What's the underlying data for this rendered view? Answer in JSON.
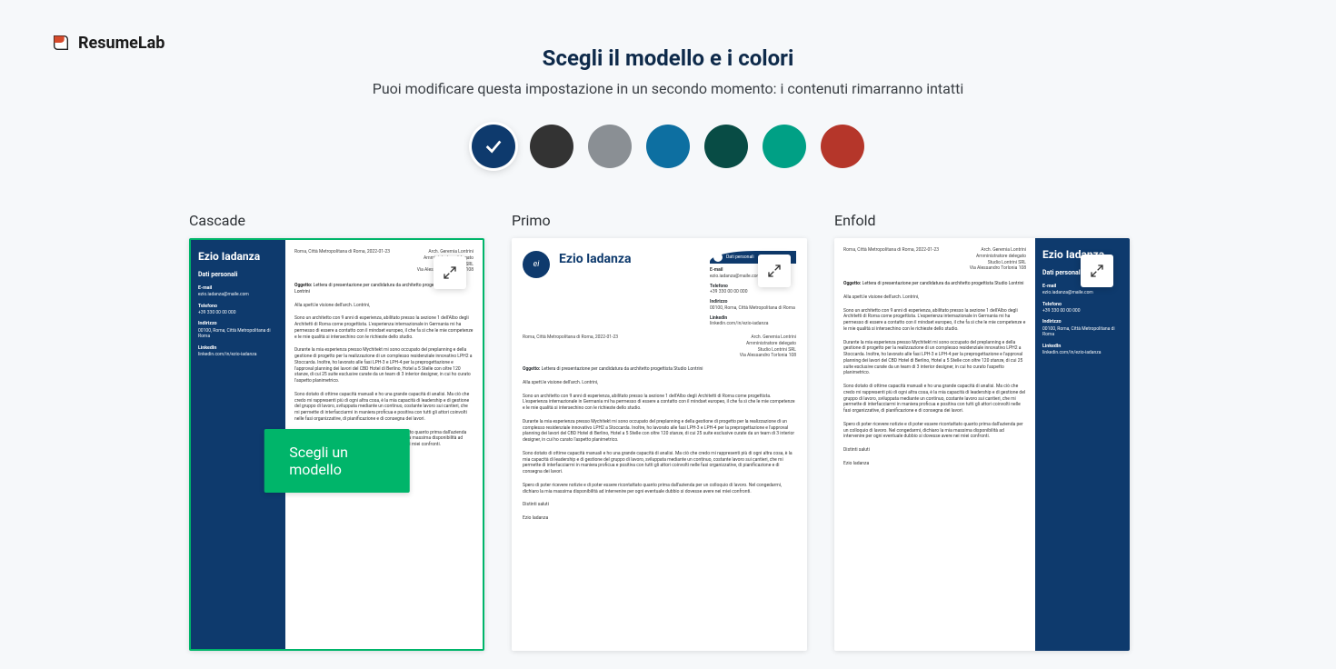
{
  "brand": "ResumeLab",
  "heading": "Scegli il modello e i colori",
  "subtitle": "Puoi modificare questa impostazione in un secondo momento: i contenuti rimarranno intatti",
  "colors": [
    {
      "name": "navy",
      "hex": "#0e3a6d",
      "selected": true
    },
    {
      "name": "charcoal",
      "hex": "#333333",
      "selected": false
    },
    {
      "name": "gray",
      "hex": "#8a8f94",
      "selected": false
    },
    {
      "name": "blue",
      "hex": "#0d6fa1",
      "selected": false
    },
    {
      "name": "dark-teal",
      "hex": "#084c45",
      "selected": false
    },
    {
      "name": "teal",
      "hex": "#00a085",
      "selected": false
    },
    {
      "name": "red",
      "hex": "#b5362a",
      "selected": false
    }
  ],
  "choose_button": "Scegli un modello",
  "templates": [
    {
      "id": "cascade",
      "label": "Cascade",
      "selected": true
    },
    {
      "id": "primo",
      "label": "Primo",
      "selected": false
    },
    {
      "id": "enfold",
      "label": "Enfold",
      "selected": false
    }
  ],
  "sample": {
    "name": "Ezio Iadanza",
    "initials": "ei",
    "side_heading": "Dati personali",
    "contact_heading": "Dati personali",
    "location_date": "Roma, Città Metropolitana di Roma, 2022-01-23",
    "recipient": {
      "l1": "Arch. Geremia Lontrini",
      "l2": "Amministratore delegato",
      "l3": "Studio Lontrini SRL",
      "l4": "Via Alessandro Torlonia 108"
    },
    "fields": {
      "email_label": "E-mail",
      "email": "ezio.iadanza@maile.com",
      "phone_label": "Telefono",
      "phone": "+39 330 00 00 000",
      "address_label": "Indirizzo",
      "address": "00100, Roma, Città Metropolitana di Roma",
      "linkedin_label": "LinkedIn",
      "linkedin": "linkedin.com/in/ezio-iadanza"
    },
    "object_label": "Oggetto:",
    "object": "Lettera di presentazione per candidatura da architetto progettista Studio Lontrini",
    "greeting": "Alla spett.le visione dell'arch. Lontrini,",
    "p1": "Sono un architetto con 9 anni di esperienza, abilitato presso la sezione 1 dell'Albo degli Architetti di Roma come progettista. L'esperienza internazionale in Germania mi ha permesso di essere a contatto con il mindset europeo, il che fa sì che le mie competenze e le mie qualità si intersechino con le richieste dello studio.",
    "p2": "Durante la mia esperienza presso Mychitekt mi sono occupato del preplanning e della gestione di progetto per la realizzazione di un complesso residenziale innovativo LPH2 a Stoccarda. Inoltre, ho lavorato alle fasi LPH-3 e LPH-4 per la preprogettazione e l'approval planning dei lavori del CBD Hotel di Berlino, Hotel a 5 Stelle con oltre 120 stanze, di cui 25 suite esclusive curate da un team di 3 interior designer, in cui ho curato l'aspetto planimetrico.",
    "p3": "Sono dotato di ottime capacità manuali e ho una grande capacità di analisi. Ma ciò che credo mi rappresenti più di ogni altra cosa, è la mia capacità di leadership e di gestione del gruppo di lavoro, sviluppata mediante un continuo, costante lavoro sui cantieri, che mi permette di interfacciarmi in maniera proficua e positiva con tutti gli attori coinvolti nelle fasi organizzative, di pianificazione e di consegna dei lavori.",
    "p4": "Spero di poter ricevere notizie e di poter essere ricontattato quanto prima dall'azienda per un colloquio di lavoro. Nel congedarmi, dichiaro la mia massima disponibilità ad intervenire per ogni eventuale dubbio si dovesse avere nei miei confronti.",
    "closing": "Distinti saluti",
    "signature": "Ezio Iadanza"
  }
}
